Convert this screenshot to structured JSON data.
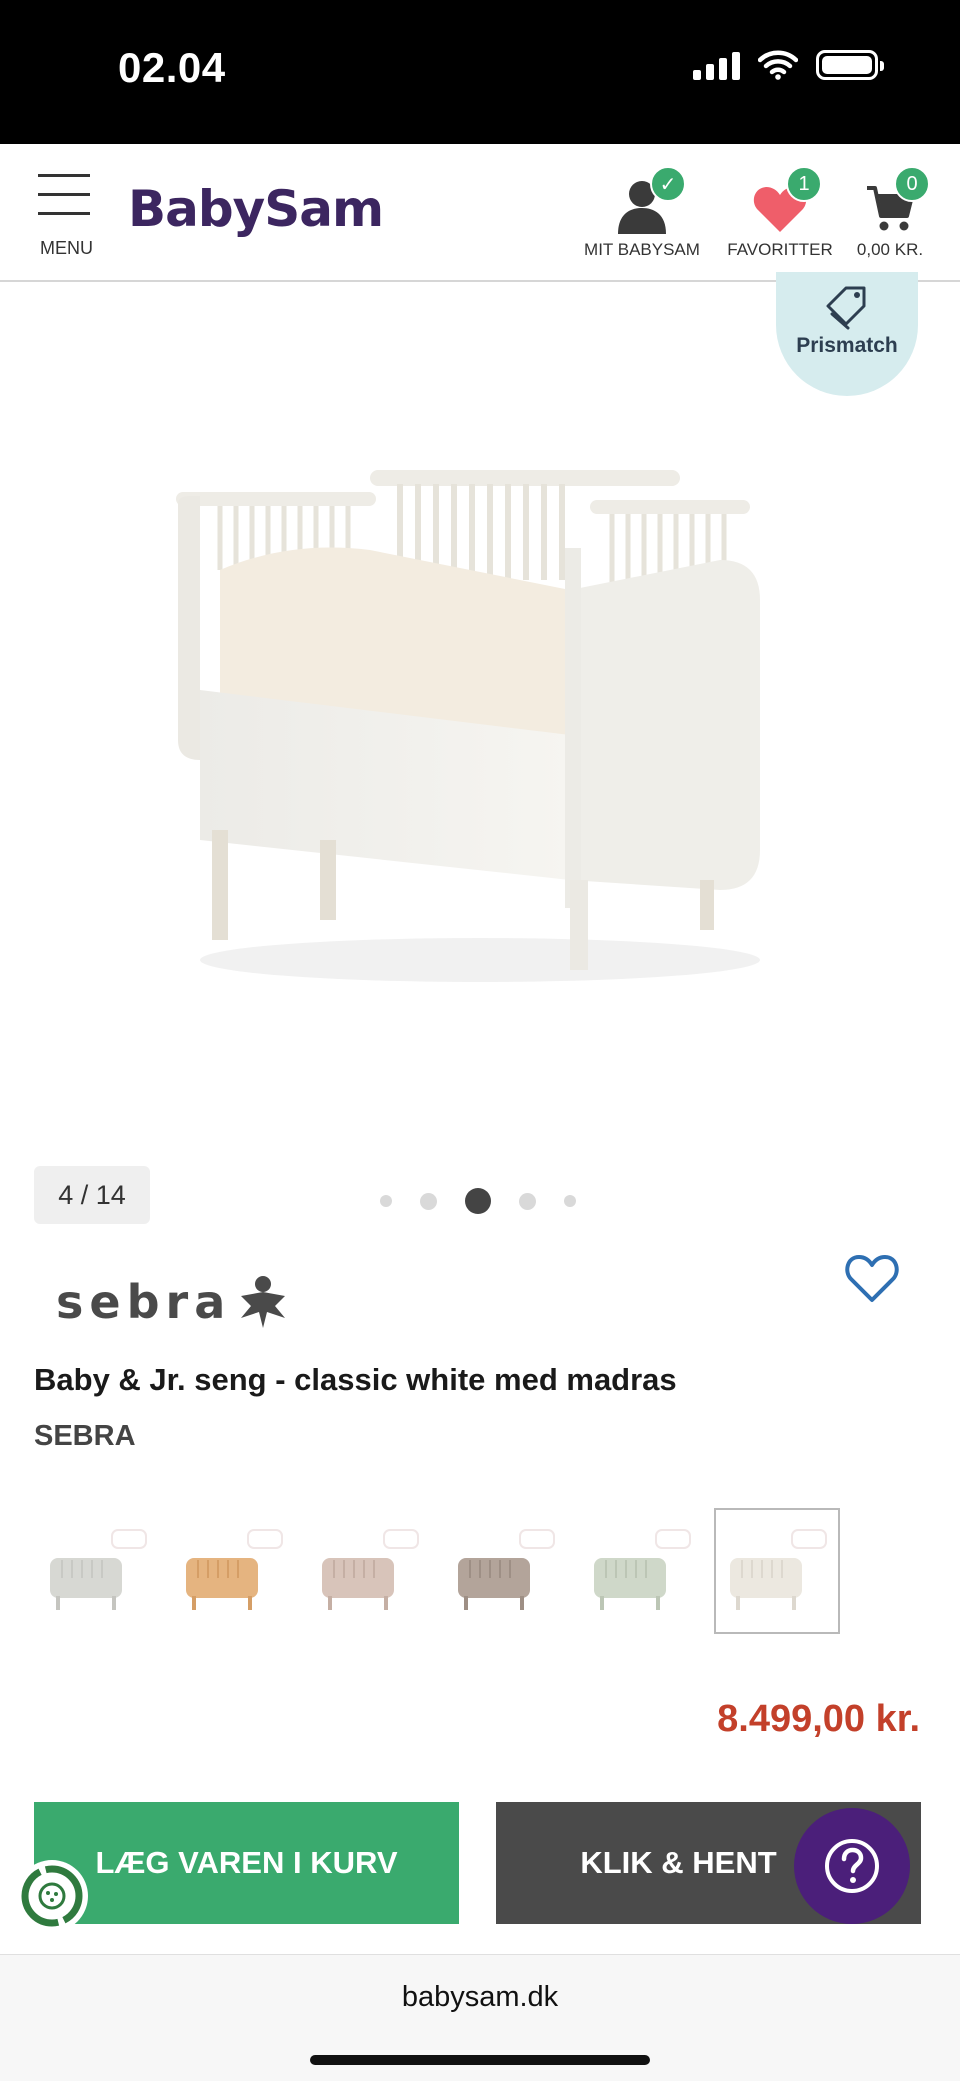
{
  "status_bar": {
    "time": "02.04"
  },
  "header": {
    "menu_label": "MENU",
    "logo": "BabySam",
    "account_label": "MIT BABYSAM",
    "favorites_label": "FAVORITTER",
    "favorites_count": "1",
    "cart_label": "0,00 KR.",
    "cart_count": "0",
    "account_badge": "✓"
  },
  "gallery": {
    "prismatch_label": "Prismatch",
    "counter": "4 / 14",
    "active_dot": 3,
    "dot_count": 5
  },
  "product": {
    "brand_logo_text": "sebra",
    "title": "Baby & Jr. seng - classic white med madras",
    "brand": "SEBRA",
    "price": "8.499,00 kr.",
    "variants": [
      {
        "color": "classic white grey",
        "hex": "#d7d8d3"
      },
      {
        "color": "honey",
        "hex": "#e5b480"
      },
      {
        "color": "rose",
        "hex": "#d8c4ba"
      },
      {
        "color": "taupe",
        "hex": "#b3a49a"
      },
      {
        "color": "sage",
        "hex": "#cfd8c9"
      },
      {
        "color": "classic white",
        "hex": "#ece8e0",
        "selected": true
      }
    ]
  },
  "actions": {
    "add_to_cart": "LÆG VAREN I KURV",
    "click_collect": "KLIK & HENT"
  },
  "browser": {
    "url": "babysam.dk"
  },
  "colors": {
    "brand_purple": "#3c2660",
    "green": "#3aaa6e",
    "price_red": "#c3402a",
    "dark_button": "#4a4a4a",
    "help_purple": "#4b1f7a"
  }
}
